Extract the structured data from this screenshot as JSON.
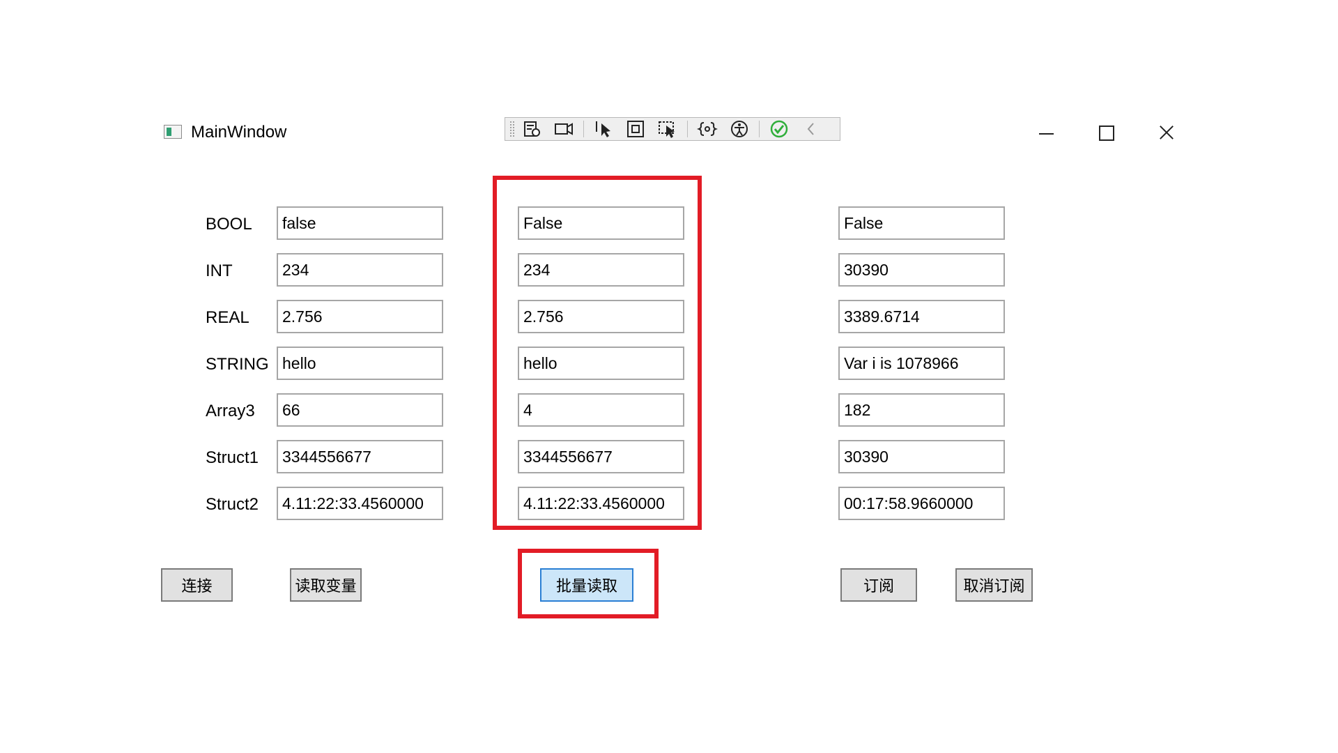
{
  "window": {
    "title": "MainWindow",
    "controls": {
      "minimize": "minimize-icon",
      "maximize": "maximize-icon",
      "close": "close-icon"
    }
  },
  "toolbar": {
    "icons": [
      "live-visual-tree-icon",
      "record-icon",
      "select-element-icon",
      "display-layout-adorners-icon",
      "track-focus-icon",
      "binding-failures-icon",
      "accessibility-icon",
      "hot-reload-ok-icon",
      "collapse-icon"
    ]
  },
  "labels": [
    "BOOL",
    "INT",
    "REAL",
    "STRING",
    "Array3",
    "Struct1",
    "Struct2"
  ],
  "columns": {
    "write": [
      "false",
      "234",
      "2.756",
      "hello",
      "66",
      "3344556677",
      "4.11:22:33.4560000"
    ],
    "batch": [
      "False",
      "234",
      "2.756",
      "hello",
      "4",
      "3344556677",
      "4.11:22:33.4560000"
    ],
    "subscribe": [
      "False",
      "30390",
      "3389.6714",
      "Var i is 1078966",
      "182",
      "30390",
      "00:17:58.9660000"
    ]
  },
  "buttons": {
    "connect": "连接",
    "read_var": "读取变量",
    "batch_read": "批量读取",
    "subscribe": "订阅",
    "unsubscribe": "取消订阅"
  },
  "colors": {
    "highlight": "#e21c26",
    "active_button": "#cce6f9",
    "hot_reload_ok": "#2fae3a"
  }
}
